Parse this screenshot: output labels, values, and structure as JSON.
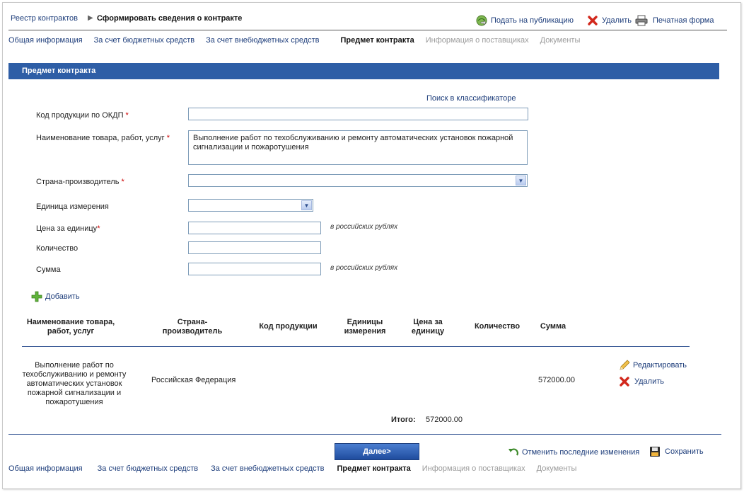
{
  "breadcrumb": {
    "root": "Реестр контрактов",
    "current": "Сформировать сведения о контракте"
  },
  "top_actions": {
    "publish": "Подать на публикацию",
    "delete": "Удалить",
    "print": "Печатная форма"
  },
  "tabs": [
    {
      "label": "Общая информация",
      "state": "link"
    },
    {
      "label": "За счет бюджетных средств",
      "state": "link"
    },
    {
      "label": "За счет внебюджетных средств",
      "state": "link"
    },
    {
      "label": "Предмет контракта",
      "state": "active"
    },
    {
      "label": "Информация о поставщиках",
      "state": "disabled"
    },
    {
      "label": "Документы",
      "state": "disabled"
    }
  ],
  "section_title": "Предмет контракта",
  "form": {
    "classifier_link": "Поиск в классификаторе",
    "okdp_label": "Код продукции по ОКДП",
    "okdp_value": "",
    "name_label": "Наименование товара, работ, услуг",
    "name_value": "Выполнение работ по техобслуживанию и ремонту автоматических установок пожарной сигнализации и пожаротушения",
    "country_label": "Страна-производитель",
    "country_value": "",
    "unit_label": "Единица измерения",
    "unit_value": "",
    "price_label": "Цена за единицу",
    "price_value": "",
    "price_hint": "в российских рублях",
    "qty_label": "Количество",
    "qty_value": "",
    "sum_label": "Сумма",
    "sum_value": "",
    "sum_hint": "в российских рублях",
    "required_mark": "*",
    "add_label": "Добавить"
  },
  "table": {
    "headers": {
      "name": "Наименование товара, работ, услуг",
      "country": "Страна-производитель",
      "code": "Код продукции",
      "unit": "Единицы измерения",
      "price": "Цена за единицу",
      "qty": "Количество",
      "sum": "Сумма"
    },
    "rows": [
      {
        "name": "Выполнение работ по техобслуживанию и ремонту автоматических установок пожарной сигнализации и пожаротушения",
        "country": "Российская Федерация",
        "code": "",
        "unit": "",
        "price": "",
        "qty": "",
        "sum": "572000.00",
        "edit_label": "Редактировать",
        "delete_label": "Удалить"
      }
    ],
    "total_label": "Итого:",
    "total_value": "572000.00"
  },
  "footer": {
    "next_label": "Далее>",
    "revert_label": "Отменить последние изменения",
    "save_label": "Сохранить"
  },
  "colors": {
    "section_header": "#2e5ea6",
    "link": "#1c3c7a",
    "disabled_tab": "#9a9a9a",
    "required": "#cc0000"
  }
}
